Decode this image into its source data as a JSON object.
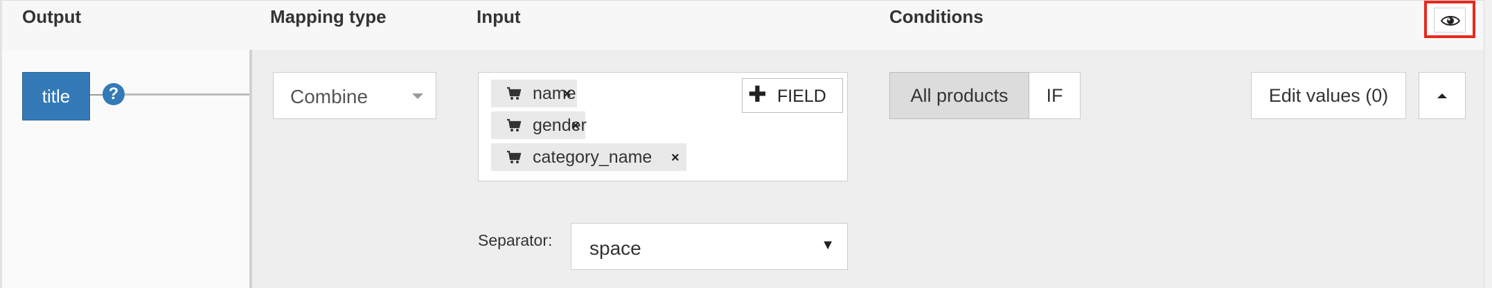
{
  "header": {
    "output": "Output",
    "mapping_type": "Mapping type",
    "input": "Input",
    "conditions": "Conditions"
  },
  "output": {
    "field": "title",
    "help": "?"
  },
  "mapping": {
    "type": "Combine"
  },
  "input": {
    "chips": [
      {
        "icon": "cart-icon",
        "label": "name",
        "remove": "×"
      },
      {
        "icon": "cart-icon",
        "label": "gender",
        "remove": "×"
      },
      {
        "icon": "cart-icon",
        "label": "category_name",
        "remove": "×"
      }
    ],
    "add_field_plus": "✚",
    "add_field_label": "FIELD",
    "separator_label": "Separator:",
    "separator_value": "space",
    "separator_arrow": "▼"
  },
  "conditions": {
    "all_products": "All products",
    "if": "IF"
  },
  "actions": {
    "edit_values": "Edit values (0)"
  },
  "colors": {
    "accent": "#337ab7",
    "highlight": "#e8281c"
  }
}
